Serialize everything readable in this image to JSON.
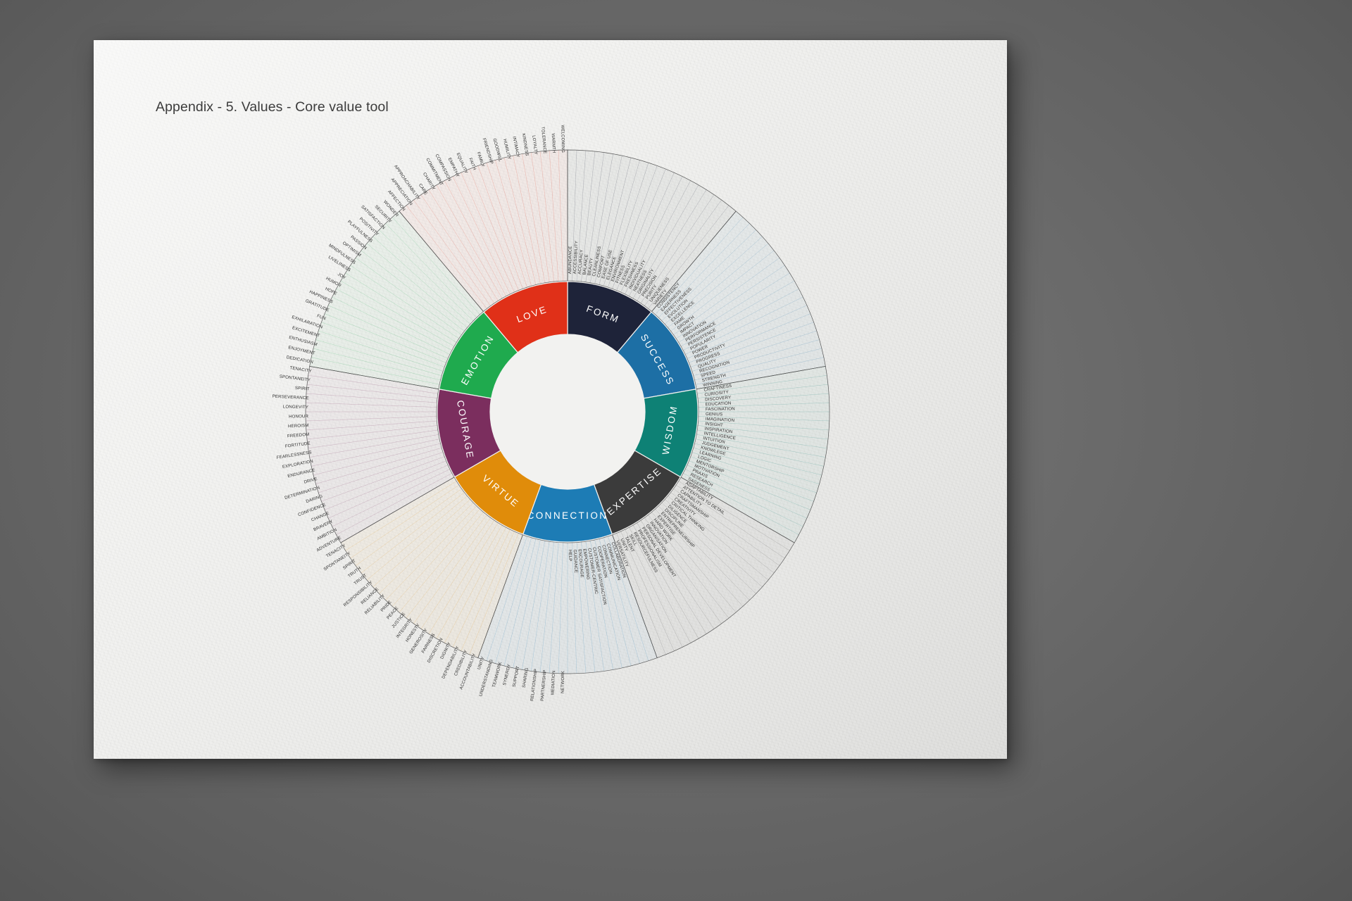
{
  "page": {
    "title": "Appendix - 5. Values - Core value tool",
    "background_color": "#6b6b6b",
    "paper_color": "#f2f2f0"
  },
  "chart_data": {
    "type": "pie",
    "title": "Appendix - 5. Values - Core value tool",
    "subtitle": "",
    "layout": "sunburst-donut",
    "inner_hole_ratio": 0.56,
    "legend_position": "none",
    "grid": false,
    "start_angle_deg": -90,
    "note": "Eight equal core-value categories; each inner ring segment fans out to its list of value words in the outer ring.",
    "categories": [
      {
        "label": "FORM",
        "color": "#1e2339",
        "text_color": "#ffffff",
        "share": 12.5,
        "values": [
          "ABUNDANCE",
          "ACCESSIBILITY",
          "ACCURACY",
          "BALANCE",
          "BEAUTY",
          "CLEANLINESS",
          "COMFORT",
          "EASE OF USE",
          "ELEGANCE",
          "ENVIRONMENT",
          "FITNESS",
          "FLEXIBILITY",
          "FRESHNESS",
          "INDIVIDUALITY",
          "NEATNESS",
          "ORIGINALITY",
          "PRECISION",
          "PURITY",
          "UNIQUENESS",
          "VARIETY"
        ]
      },
      {
        "label": "SUCCESS",
        "color": "#1d6fa5",
        "text_color": "#ffffff",
        "share": 12.5,
        "values": [
          "CONSISTENCY",
          "EAGERNESS",
          "EFFECTIVENESS",
          "EVOLUTION",
          "EXCELLENCE",
          "FAME",
          "GROWTH",
          "IMPACT",
          "INNOVATION",
          "PERFORMANCE",
          "PERSISTENCE",
          "POPULARITY",
          "POWER",
          "PRODUCTIVITY",
          "PROGRESS",
          "QUALITY",
          "RECOGNITION",
          "SPEED",
          "STRENGTH",
          "WINNING"
        ]
      },
      {
        "label": "WISDOM",
        "color": "#0e8175",
        "text_color": "#ffffff",
        "share": 12.5,
        "values": [
          "CRAFTINESS",
          "CURIOSITY",
          "DISCOVERY",
          "EDUCATION",
          "FASCINATION",
          "GENIUS",
          "IMAGINATION",
          "INSIGHT",
          "INSPIRATION",
          "INTELLIGENCE",
          "INTUITION",
          "JUDGEMENT",
          "KNOWLEGE",
          "LEARNING",
          "LOGIC",
          "MENTORSHIP",
          "MOTIVATION",
          "PRAXIS",
          "RESEARCH",
          "SAGENESS"
        ]
      },
      {
        "label": "EXPERTISE",
        "color": "#3b3b3b",
        "text_color": "#ffffff",
        "share": 12.5,
        "values": [
          "ADAPTABILITY",
          "ATTENTION TO DETAIL",
          "CAPABILITY",
          "CRAFTSMANSHIP",
          "CREATIVITY",
          "CRITICAL THINKING",
          "DILIGENCE",
          "DISCIPLINE",
          "ENTREPRENEURSHIP",
          "EXPERTISE",
          "HARD WORK",
          "INNOVATION",
          "ORGANISATION",
          "PERSONAL DEVELOPMENT",
          "PROFESSIONALISM",
          "RESOURCEFULNESS",
          "SKILL",
          "TALENT",
          "UNITY",
          "VERSATILITY"
        ]
      },
      {
        "label": "CONNECTION",
        "color": "#1d7cb5",
        "text_color": "#ffffff",
        "share": 12.5,
        "values": [
          "COLLABORATION",
          "COMMUNICATION",
          "CONNECTION",
          "COOPERATION",
          "CUSTOMER SATISFACTION",
          "CUSTOMER-CENTRIC",
          "EMPOWERING",
          "ENCOURAGE",
          "GUIDANCE",
          "HELP",
          "NETWORK",
          "MEDIATION",
          "PARTNERSHIP",
          "RELATIONSHIP",
          "SHARING",
          "SUPPORT",
          "SYNERGY",
          "TEAMWORK",
          "UNDERSTANDING",
          "UNITY"
        ]
      },
      {
        "label": "VIRTUE",
        "color": "#e08c0a",
        "text_color": "#ffffff",
        "share": 12.5,
        "values": [
          "ACCOUNTABILITY",
          "CREDIBILITY",
          "DEPENDABILITY",
          "DIGNITY",
          "DISCRETION",
          "FAIRNESS",
          "GENEROSITY",
          "HONESTY",
          "INTEGRITY",
          "JUSTICE",
          "PEACE",
          "PRIDE",
          "RELIABILITY",
          "RELIANCE",
          "RESPONSIBILITY",
          "TRUST",
          "TRUTH",
          "SPIRIT",
          "SPONTANEITY",
          "TENACITY"
        ]
      },
      {
        "label": "COURAGE",
        "color": "#7b2e5e",
        "text_color": "#ffffff",
        "share": 12.5,
        "values": [
          "ADVENTURE",
          "AMBITION",
          "BRAVERY",
          "CHANGE",
          "CONFIDENCE",
          "DARING",
          "DETERMINATION",
          "DRIVE",
          "ENDURANCE",
          "EXPLORATION",
          "FEARLESSNESS",
          "FORTITUDE",
          "FREEDOM",
          "HEROISM",
          "HONOUR",
          "LONGEVITY",
          "PERSEVERANCE",
          "SPIRIT",
          "SPONTANEITY",
          "TENACITY"
        ]
      },
      {
        "label": "EMOTION",
        "color": "#1faa4e",
        "text_color": "#ffffff",
        "share": 12.5,
        "values": [
          "DEDICATION",
          "ENJOYMENT",
          "ENTHUSIASM",
          "EXCITEMENT",
          "EXHILARATION",
          "FUN",
          "GRATITUDE",
          "HAPPINESS",
          "HOPE",
          "HUMOR",
          "JOY",
          "LIVELINESS",
          "MINDFULNESS",
          "OPTIMISM",
          "PASSION",
          "PLAYFULNESS",
          "POSITIVITY",
          "SATISFACTION",
          "SECURITY",
          "WONDER"
        ]
      },
      {
        "label": "LOVE",
        "color": "#e03018",
        "text_color": "#ffffff",
        "share": 12.5,
        "values": [
          "AFFECTION",
          "APPRECIATION",
          "APPROACHABILITY",
          "CARE",
          "CHARITY",
          "COMMITMENT",
          "COMPASSION",
          "EMPATHY",
          "EQUALITY",
          "FAITH",
          "FAMILY",
          "FRIENDSHIP",
          "GOODWILL",
          "HUMILITY",
          "INTIMACY",
          "KINDNESS",
          "LOYALTY",
          "TOLERANCE",
          "WARMTH",
          "WELCOMING"
        ]
      }
    ]
  }
}
